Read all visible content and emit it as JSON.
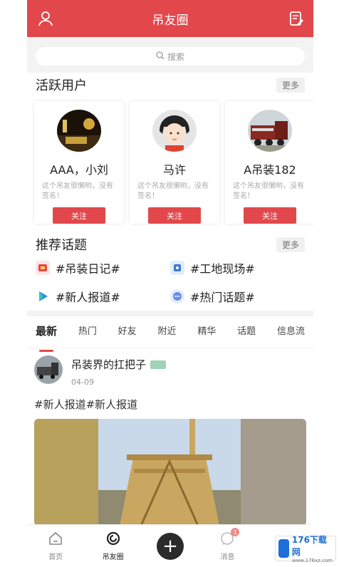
{
  "header": {
    "title": "吊友圈",
    "left_icon": "user-icon",
    "right_icon": "edit-icon"
  },
  "search": {
    "placeholder": "搜索"
  },
  "active_users": {
    "title": "活跃用户",
    "more_label": "更多",
    "users": [
      {
        "name": "AAA，小刘",
        "signature": "这个吊友很懒哟，没有签名！",
        "follow_label": "关注"
      },
      {
        "name": "马许",
        "signature": "这个吊友很懒哟，没有签名！",
        "follow_label": "关注"
      },
      {
        "name": "A吊装182",
        "signature": "这个吊友很懒哟，没有签名！",
        "follow_label": "关注"
      }
    ]
  },
  "topics": {
    "title": "推荐话题",
    "more_label": "更多",
    "items": [
      {
        "label": "#吊装日记#",
        "color": "#e2474c"
      },
      {
        "label": "#工地现场#",
        "color": "#3a7bd5"
      },
      {
        "label": "#新人报道#",
        "color": "#2b8be6"
      },
      {
        "label": "#热门话题#",
        "color": "#6a8ee8"
      }
    ]
  },
  "feed_tabs": [
    "最新",
    "热门",
    "好友",
    "附近",
    "精华",
    "话题",
    "信息流"
  ],
  "post": {
    "author": "吊装界的扛把子",
    "date": "04-09",
    "text": "#新人报道#新人报道"
  },
  "tabbar": {
    "items": [
      {
        "label": "首页"
      },
      {
        "label": "吊友圈"
      },
      {
        "label": ""
      },
      {
        "label": "消息",
        "badge": "1"
      }
    ]
  },
  "watermark": {
    "main": "176下载网",
    "sub": "www.176xz.com"
  },
  "colors": {
    "brand": "#e2474c"
  }
}
